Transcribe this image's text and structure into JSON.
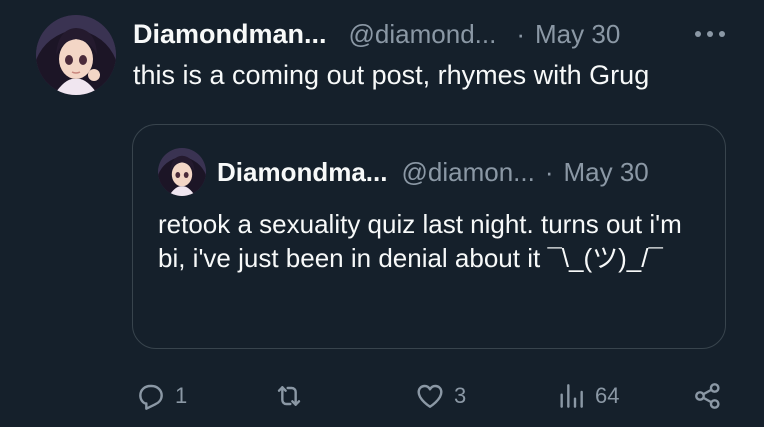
{
  "tweet": {
    "author_name": "Diamondman...",
    "author_handle": "@diamond...",
    "separator": "·",
    "date": "May 30",
    "text": "this is a coming out post, rhymes with Grug",
    "more_icon": "more-horizontal-icon"
  },
  "quote": {
    "author_name": "Diamondma...",
    "author_handle": "@diamon...",
    "separator": "·",
    "date": "May 30",
    "text": "retook a sexuality quiz last night. turns out i'm bi, i've just been in denial about it ¯\\_(ツ)_/¯"
  },
  "actions": {
    "reply": {
      "icon": "reply-icon",
      "count": "1"
    },
    "repost": {
      "icon": "repost-icon",
      "count": ""
    },
    "like": {
      "icon": "heart-icon",
      "count": "3"
    },
    "views": {
      "icon": "views-icon",
      "count": "64"
    },
    "share": {
      "icon": "share-icon"
    }
  },
  "colors": {
    "background": "#15202b",
    "text_primary": "#f7f9f9",
    "text_secondary": "#8b98a5",
    "border": "#38444d"
  }
}
